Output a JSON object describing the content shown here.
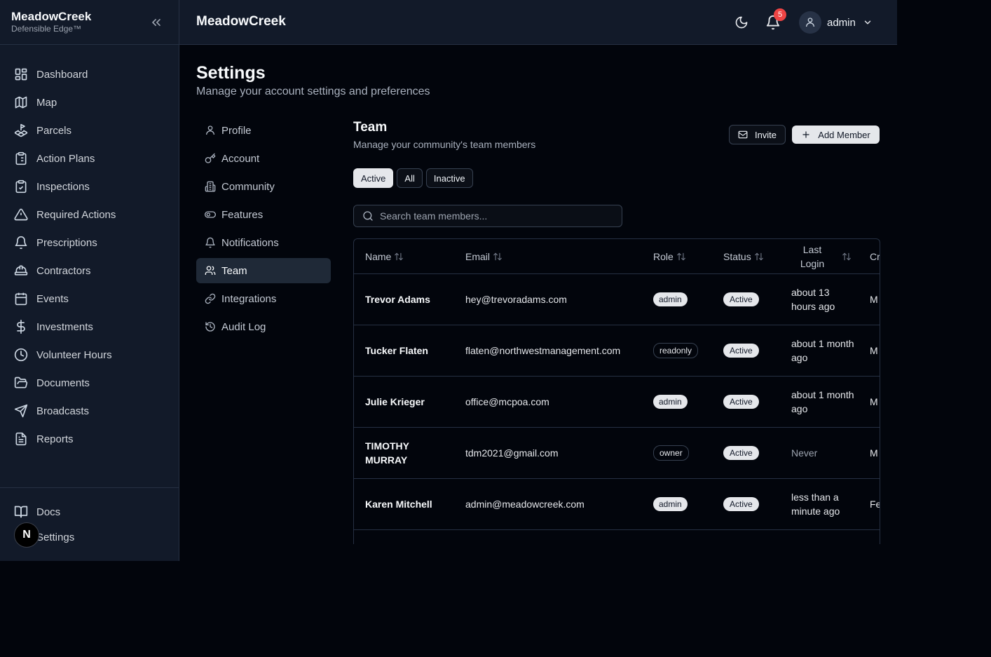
{
  "sidebar": {
    "brand_name": "MeadowCreek",
    "brand_sub": "Defensible Edge™",
    "items": [
      {
        "label": "Dashboard"
      },
      {
        "label": "Map"
      },
      {
        "label": "Parcels"
      },
      {
        "label": "Action Plans"
      },
      {
        "label": "Inspections"
      },
      {
        "label": "Required Actions"
      },
      {
        "label": "Prescriptions"
      },
      {
        "label": "Contractors"
      },
      {
        "label": "Events"
      },
      {
        "label": "Investments"
      },
      {
        "label": "Volunteer Hours"
      },
      {
        "label": "Documents"
      },
      {
        "label": "Broadcasts"
      },
      {
        "label": "Reports"
      }
    ],
    "bottom_items": [
      {
        "label": "Docs"
      },
      {
        "label": "Settings"
      }
    ],
    "n_badge": "N"
  },
  "header": {
    "title": "MeadowCreek",
    "notification_count": "5",
    "user_name": "admin"
  },
  "page": {
    "title": "Settings",
    "subtitle": "Manage your account settings and preferences"
  },
  "settings_nav": [
    {
      "label": "Profile"
    },
    {
      "label": "Account"
    },
    {
      "label": "Community"
    },
    {
      "label": "Features"
    },
    {
      "label": "Notifications"
    },
    {
      "label": "Team",
      "active": true
    },
    {
      "label": "Integrations"
    },
    {
      "label": "Audit Log"
    }
  ],
  "team": {
    "title": "Team",
    "subtitle": "Manage your community's team members",
    "invite_label": "Invite",
    "add_label": "Add Member",
    "filters": [
      "Active",
      "All",
      "Inactive"
    ],
    "active_filter": "Active",
    "search_placeholder": "Search team members...",
    "columns": [
      "Name",
      "Email",
      "Role",
      "Status",
      "Last Login",
      "Cr"
    ],
    "rows": [
      {
        "name": "Trevor Adams",
        "email": "hey@trevoradams.com",
        "role": "admin",
        "status": "Active",
        "last_login": "about 13 hours ago",
        "created": "M"
      },
      {
        "name": "Tucker Flaten",
        "email": "flaten@northwestmanagement.com",
        "role": "readonly",
        "status": "Active",
        "last_login": "about 1 month ago",
        "created": "M"
      },
      {
        "name": "Julie Krieger",
        "email": "office@mcpoa.com",
        "role": "admin",
        "status": "Active",
        "last_login": "about 1 month ago",
        "created": "M"
      },
      {
        "name": "TIMOTHY MURRAY",
        "email": "tdm2021@gmail.com",
        "role": "owner",
        "status": "Active",
        "last_login": "Never",
        "created": "M"
      },
      {
        "name": "Karen Mitchell",
        "email": "admin@meadowcreek.com",
        "role": "admin",
        "status": "Active",
        "last_login": "less than a minute ago",
        "created": "Fe"
      }
    ]
  },
  "colors": {
    "background": "#02050c",
    "panel": "#121a29",
    "border": "#263043",
    "badge_red": "#ef4444",
    "badge_light": "#e5e7eb"
  }
}
